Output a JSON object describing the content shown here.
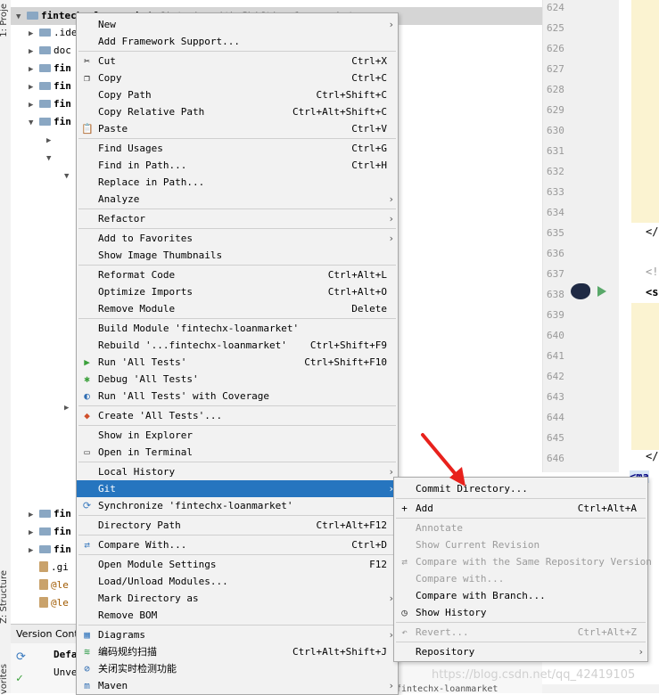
{
  "left_strip": {
    "top_label": "1: Proje",
    "bottom_label": "Z: Structure",
    "bottom2": "vorites"
  },
  "tree": {
    "rows": [
      {
        "text": "fintechx-loanmarket",
        "suffix": "  fintechx with Shifting loanmarket"
      },
      {
        "text": ".idea"
      },
      {
        "text": "doc"
      },
      {
        "text": "fin"
      },
      {
        "text": "fin"
      },
      {
        "text": "fin"
      },
      {
        "text": "fin"
      },
      {
        "text": ".gi"
      },
      {
        "text": "@le"
      },
      {
        "text": "@le"
      }
    ]
  },
  "editor": {
    "lines": [
      "624",
      "625",
      "626",
      "627",
      "628",
      "629",
      "630",
      "631",
      "632",
      "633",
      "634",
      "635",
      "636",
      "637",
      "638",
      "639",
      "640",
      "641",
      "642",
      "643",
      "644",
      "645",
      "646"
    ],
    "code_snips": [
      "</",
      "<!",
      "<s",
      "</",
      "<ma"
    ]
  },
  "bottom": {
    "tab": "Version Cont",
    "item1": "Defa",
    "item2": "Unve",
    "status": "fintechx-loanmarket"
  },
  "main_menu": [
    {
      "label": "New",
      "arrow": true
    },
    {
      "label": "Add Framework Support..."
    },
    {
      "sep": true
    },
    {
      "label": "Cut",
      "shortcut": "Ctrl+X",
      "icon": "scissors-icon"
    },
    {
      "label": "Copy",
      "shortcut": "Ctrl+C",
      "icon": "copy-icon"
    },
    {
      "label": "Copy Path",
      "shortcut": "Ctrl+Shift+C"
    },
    {
      "label": "Copy Relative Path",
      "shortcut": "Ctrl+Alt+Shift+C"
    },
    {
      "label": "Paste",
      "shortcut": "Ctrl+V",
      "icon": "paste-icon"
    },
    {
      "sep": true
    },
    {
      "label": "Find Usages",
      "shortcut": "Ctrl+G"
    },
    {
      "label": "Find in Path...",
      "shortcut": "Ctrl+H"
    },
    {
      "label": "Replace in Path..."
    },
    {
      "label": "Analyze",
      "arrow": true
    },
    {
      "sep": true
    },
    {
      "label": "Refactor",
      "arrow": true
    },
    {
      "sep": true
    },
    {
      "label": "Add to Favorites",
      "arrow": true
    },
    {
      "label": "Show Image Thumbnails"
    },
    {
      "sep": true
    },
    {
      "label": "Reformat Code",
      "shortcut": "Ctrl+Alt+L"
    },
    {
      "label": "Optimize Imports",
      "shortcut": "Ctrl+Alt+O"
    },
    {
      "label": "Remove Module",
      "shortcut": "Delete"
    },
    {
      "sep": true
    },
    {
      "label": "Build Module 'fintechx-loanmarket'"
    },
    {
      "label": "Rebuild '...fintechx-loanmarket'",
      "shortcut": "Ctrl+Shift+F9"
    },
    {
      "label": "Run 'All Tests'",
      "shortcut": "Ctrl+Shift+F10",
      "icon": "run-icon"
    },
    {
      "label": "Debug 'All Tests'",
      "icon": "debug-icon"
    },
    {
      "label": "Run 'All Tests' with Coverage",
      "icon": "coverage-icon"
    },
    {
      "sep": true
    },
    {
      "label": "Create 'All Tests'...",
      "icon": "create-config-icon"
    },
    {
      "sep": true
    },
    {
      "label": "Show in Explorer"
    },
    {
      "label": "Open in Terminal",
      "icon": "terminal-icon"
    },
    {
      "sep": true
    },
    {
      "label": "Local History",
      "arrow": true
    },
    {
      "label": "Git",
      "arrow": true,
      "selected": true
    },
    {
      "label": "Synchronize 'fintechx-loanmarket'",
      "icon": "sync-icon"
    },
    {
      "sep": true
    },
    {
      "label": "Directory Path",
      "shortcut": "Ctrl+Alt+F12"
    },
    {
      "sep": true
    },
    {
      "label": "Compare With...",
      "shortcut": "Ctrl+D",
      "icon": "compare-icon"
    },
    {
      "sep": true
    },
    {
      "label": "Open Module Settings",
      "shortcut": "F12"
    },
    {
      "label": "Load/Unload Modules..."
    },
    {
      "label": "Mark Directory as",
      "arrow": true
    },
    {
      "label": "Remove BOM"
    },
    {
      "sep": true
    },
    {
      "label": "Diagrams",
      "arrow": true,
      "icon": "diagrams-icon"
    },
    {
      "label": "编码规约扫描",
      "shortcut": "Ctrl+Alt+Shift+J",
      "icon": "scan-icon",
      "cjk": true
    },
    {
      "label": "关闭实时检测功能",
      "icon": "disable-icon",
      "cjk": true
    },
    {
      "label": "Maven",
      "arrow": true,
      "icon": "maven-icon"
    }
  ],
  "git_submenu": [
    {
      "label": "Commit Directory..."
    },
    {
      "sep": true
    },
    {
      "label": "Add",
      "shortcut": "Ctrl+Alt+A",
      "icon": "plus-icon"
    },
    {
      "sep": true
    },
    {
      "label": "Annotate",
      "disabled": true
    },
    {
      "label": "Show Current Revision",
      "disabled": true
    },
    {
      "label": "Compare with the Same Repository Version",
      "disabled": true,
      "icon": "compare-icon"
    },
    {
      "label": "Compare with...",
      "disabled": true
    },
    {
      "label": "Compare with Branch..."
    },
    {
      "label": "Show History",
      "icon": "history-icon"
    },
    {
      "sep": true
    },
    {
      "label": "Revert...",
      "shortcut": "Ctrl+Alt+Z",
      "disabled": true,
      "icon": "revert-icon"
    },
    {
      "sep": true
    },
    {
      "label": "Repository",
      "arrow": true
    }
  ],
  "watermark": "https://blog.csdn.net/qq_42419105",
  "colors": {
    "selection": "#2675bf",
    "menu_bg": "#f2f2f2",
    "arrow": "#e8211c",
    "disabled": "#9b9b9b"
  }
}
